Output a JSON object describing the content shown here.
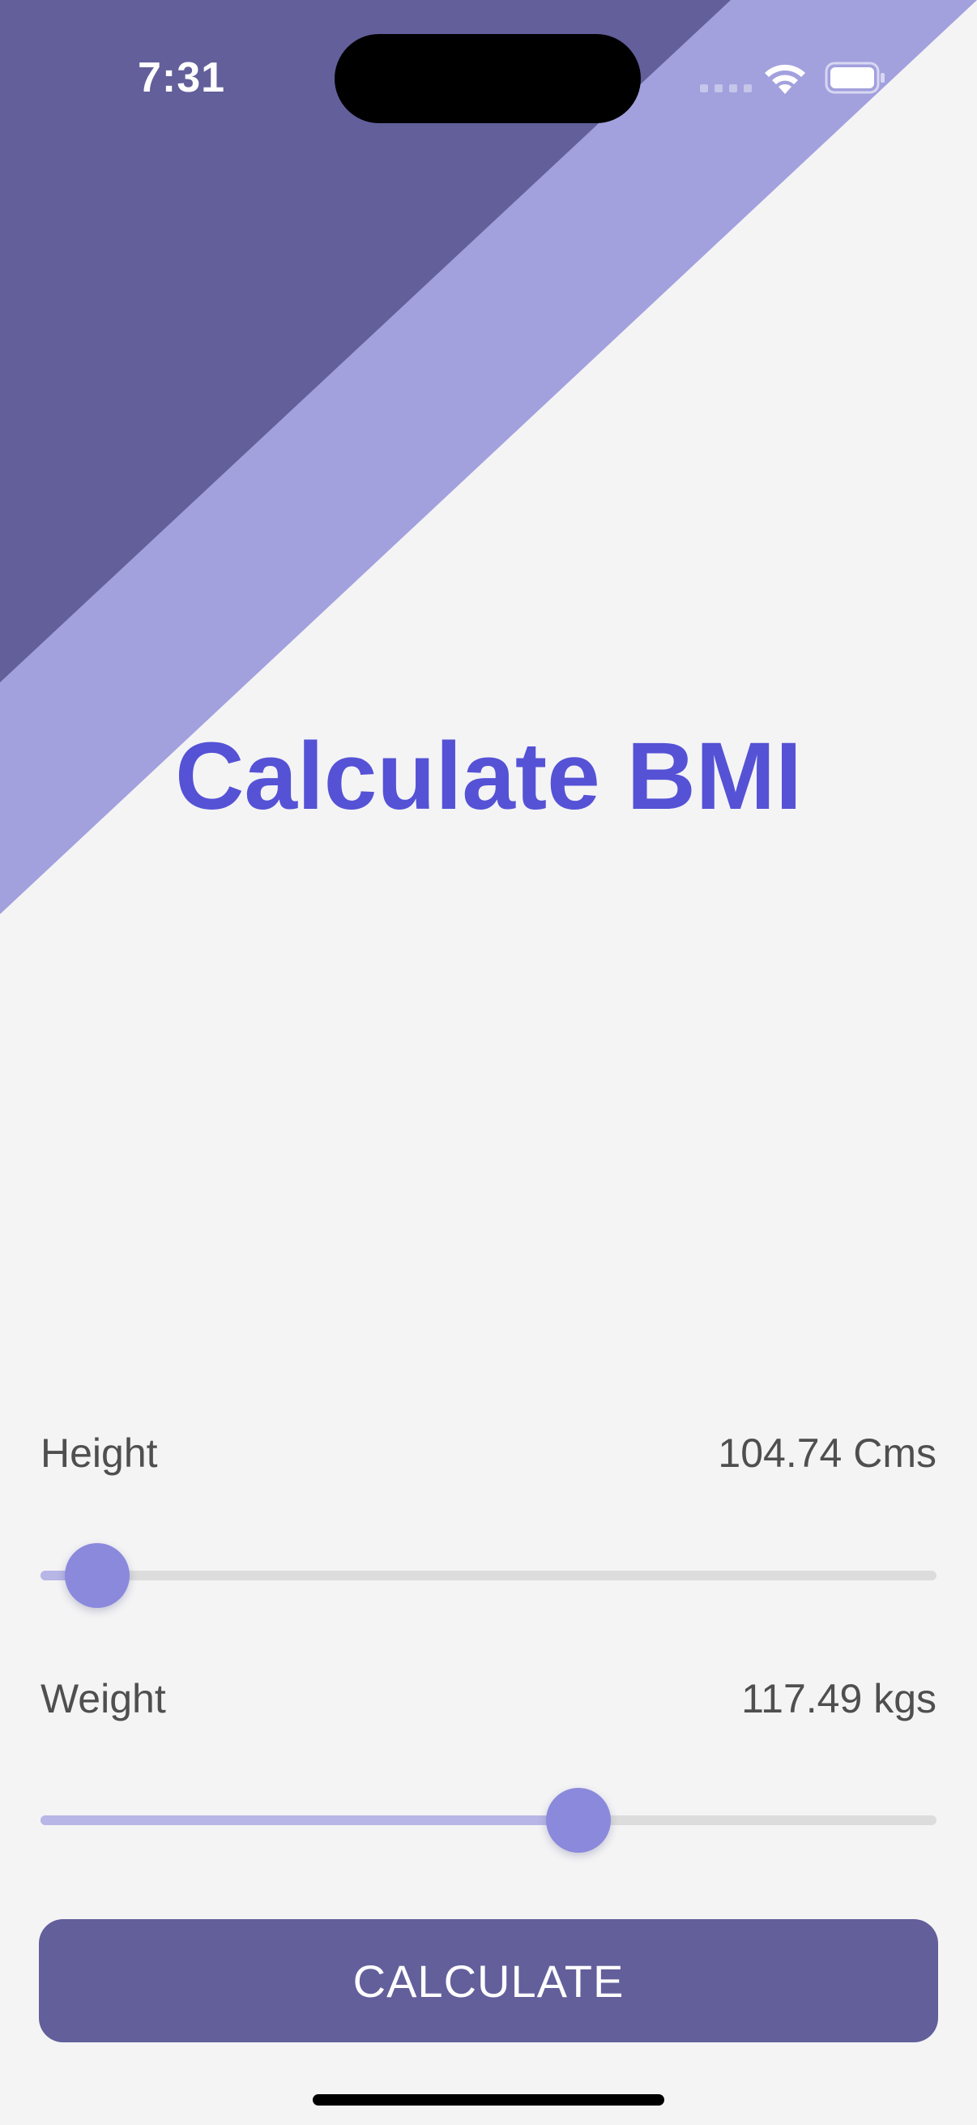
{
  "status_bar": {
    "time": "7:31"
  },
  "colors": {
    "background": "#f4f4f5",
    "dark_band": "#625f9b",
    "light_band": "#a2a0dd",
    "title": "#5552d6",
    "slider_thumb": "#8b89dc",
    "button": "#625f9b"
  },
  "title": "Calculate BMI",
  "height": {
    "label": "Height",
    "value": "104.74 Cms",
    "slider_fraction": 0.063
  },
  "weight": {
    "label": "Weight",
    "value": "117.49 kgs",
    "slider_fraction": 0.6
  },
  "button": {
    "label": "CALCULATE"
  }
}
